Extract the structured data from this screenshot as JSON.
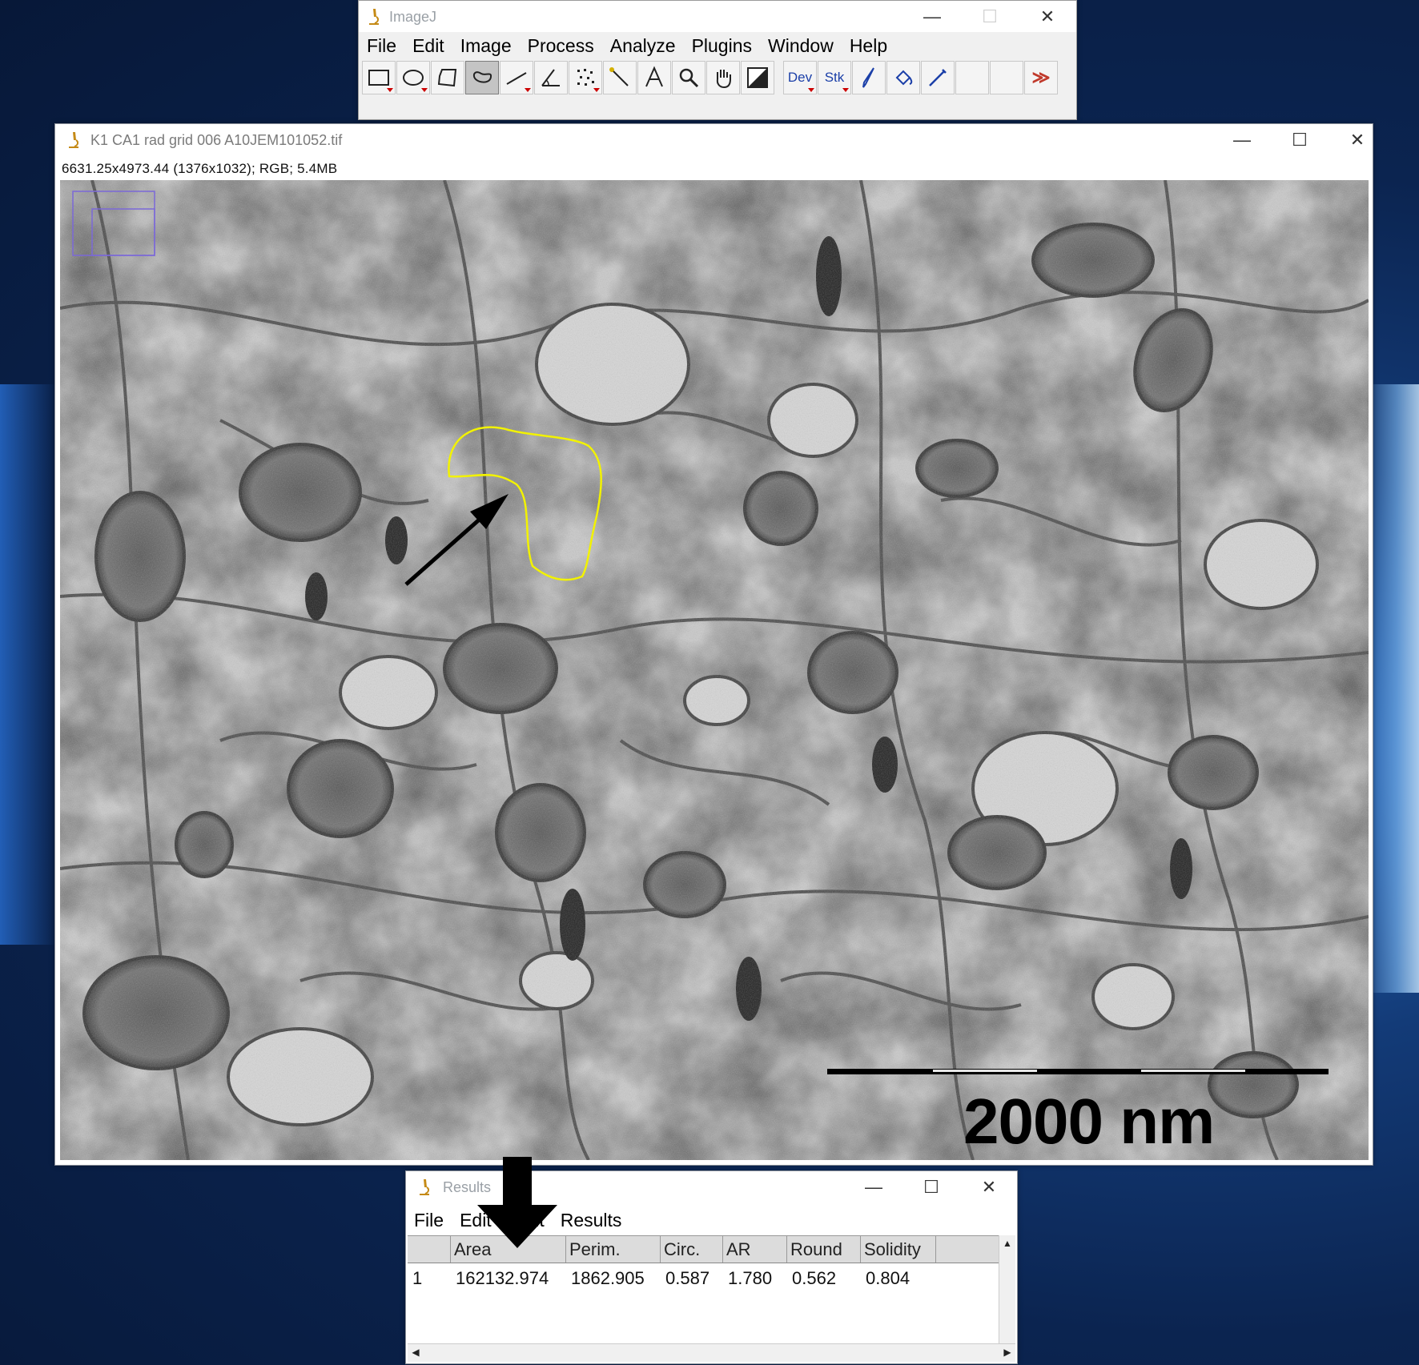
{
  "imagej": {
    "title": "ImageJ",
    "menus": [
      "File",
      "Edit",
      "Image",
      "Process",
      "Analyze",
      "Plugins",
      "Window",
      "Help"
    ],
    "tools": {
      "dev_label": "Dev",
      "stk_label": "Stk",
      "more_label": "≫"
    }
  },
  "image_window": {
    "title": "K1 CA1 rad grid 006 A10JEM101052.tif",
    "info": "6631.25x4973.44  (1376x1032); RGB; 5.4MB",
    "scale_bar_label": "2000 nm"
  },
  "results": {
    "title": "Results",
    "menus": [
      "File",
      "Edit",
      "Font",
      "Results"
    ],
    "columns": [
      "",
      "Area",
      "Perim.",
      "Circ.",
      "AR",
      "Round",
      "Solidity"
    ],
    "rows": [
      [
        "1",
        "162132.974",
        "1862.905",
        "0.587",
        "1.780",
        "0.562",
        "0.804"
      ]
    ]
  },
  "colors": {
    "roi_outline": "#f2f200",
    "desktop": "#0b2450"
  }
}
